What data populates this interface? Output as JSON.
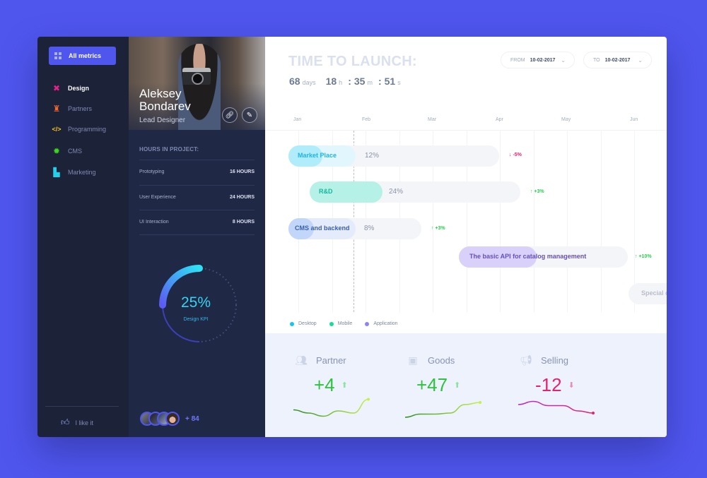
{
  "nav": {
    "all_metrics": "All metrics",
    "items": [
      {
        "label": "Design",
        "icon": "tools-icon",
        "color": "#e6218a",
        "active": true
      },
      {
        "label": "Partners",
        "icon": "stamp-icon",
        "color": "#f2672b",
        "active": false
      },
      {
        "label": "Programming",
        "icon": "code-icon",
        "color": "#f6c521",
        "active": false
      },
      {
        "label": "CMS",
        "icon": "gear-icon",
        "color": "#3ed61c",
        "active": false
      },
      {
        "label": "Marketing",
        "icon": "presenter-chart-icon",
        "color": "#21d0ea",
        "active": false
      }
    ],
    "like": "I like it"
  },
  "profile": {
    "first_name": "Aleksey",
    "last_name": "Bondarev",
    "role": "Lead Designer",
    "hours_title": "HOURS IN PROJECT:",
    "hours": [
      {
        "label": "Prototyping",
        "value": "16 HOURS"
      },
      {
        "label": "User Experience",
        "value": "24 HOURS"
      },
      {
        "label": "UI Interaction",
        "value": "8 HOURS"
      }
    ],
    "kpi": {
      "value": "25%",
      "fraction": 0.25,
      "label": "Design KPI"
    },
    "followers_more": "+ 84"
  },
  "header": {
    "title": "TIME TO LAUNCH:",
    "days": "68",
    "days_unit": "days",
    "hours": "18",
    "hours_unit": "h",
    "minutes": "35",
    "minutes_unit": "m",
    "seconds": "51",
    "seconds_unit": "s",
    "from_label": "FROM",
    "from_value": "10-02-2017",
    "to_label": "TO",
    "to_value": "10-02-2017"
  },
  "gantt": {
    "months": [
      "Jan",
      "Feb",
      "Mar",
      "Apr",
      "May",
      "Jun"
    ],
    "tasks": [
      {
        "label": "Market Place",
        "progress": "12%",
        "delta": "-5%",
        "trend": "down",
        "color": "#1cb6e6",
        "fill": "#e2f6fd",
        "cap": "#b1ecfb"
      },
      {
        "label": "R&D",
        "progress": "24%",
        "delta": "+3%",
        "trend": "up",
        "color": "#14b79a",
        "fill": "#b6f1e8",
        "cap": "#b6f1e8"
      },
      {
        "label": "CMS and backend",
        "progress": "8%",
        "delta": "+3%",
        "trend": "up",
        "color": "#3a5fa8",
        "fill": "#e4ebfb",
        "cap": "#c2d6fa"
      },
      {
        "label": "The basic API for catalog management",
        "progress": "",
        "delta": "+10%",
        "trend": "up",
        "color": "#6750b9",
        "fill": "#f4f5f8",
        "cap": "#d9d1fa"
      },
      {
        "label": "Special offers and",
        "progress": "",
        "delta": "",
        "trend": "",
        "color": "#b8bdc8",
        "fill": "#f4f5f8",
        "cap": "#f4f5f8"
      }
    ],
    "legend": [
      {
        "label": "Desktop",
        "color": "#19c4ea"
      },
      {
        "label": "Mobile",
        "color": "#15dc96"
      },
      {
        "label": "Application",
        "color": "#8f84ec"
      }
    ],
    "up_color": "#27d04b",
    "down_color": "#e5226e"
  },
  "stats": [
    {
      "label": "Partner",
      "icon": "partners-icon",
      "value": "+4",
      "trend": "up",
      "color": "#2ec23f",
      "series": [
        0.45,
        0.3,
        0.15,
        0.4,
        0.3,
        0.95
      ]
    },
    {
      "label": "Goods",
      "icon": "box-icon",
      "value": "+47",
      "trend": "up",
      "color": "#2ec23f",
      "series": [
        0.1,
        0.25,
        0.25,
        0.3,
        0.7,
        0.8
      ]
    },
    {
      "label": "Selling",
      "icon": "megaphone-icon",
      "value": "-12",
      "trend": "down",
      "color": "#e5226e",
      "series": [
        0.7,
        0.85,
        0.65,
        0.65,
        0.4,
        0.3
      ]
    }
  ]
}
